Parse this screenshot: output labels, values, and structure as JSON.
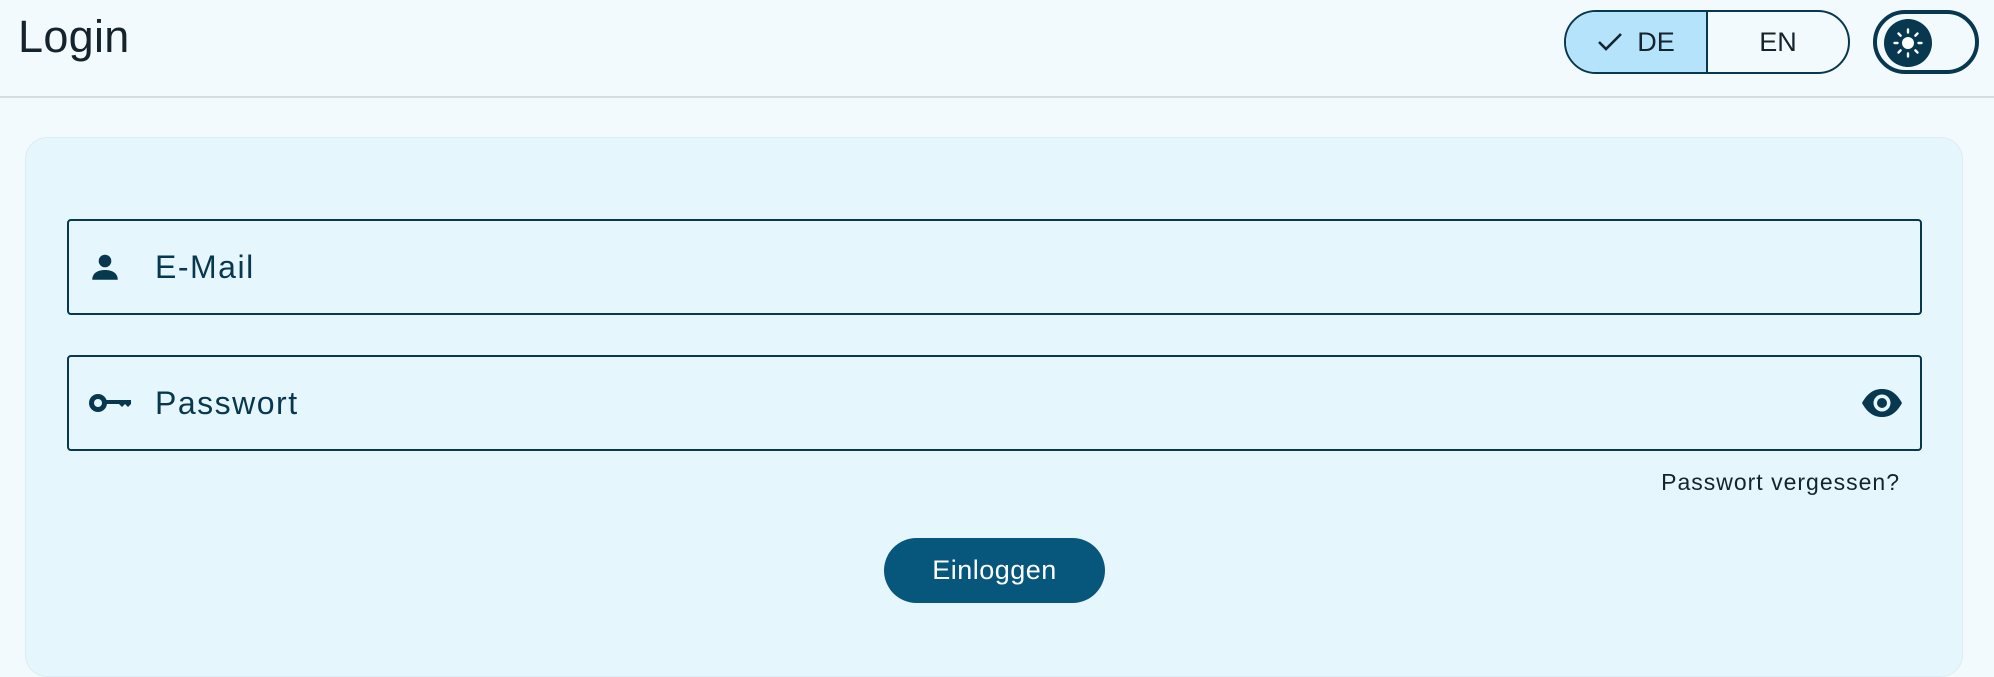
{
  "header": {
    "title": "Login",
    "language_toggle": {
      "options": [
        {
          "code": "DE",
          "label": "DE",
          "selected": true
        },
        {
          "code": "EN",
          "label": "EN",
          "selected": false
        }
      ]
    },
    "theme_switch": {
      "icon": "sun-icon",
      "state": "light"
    }
  },
  "form": {
    "email": {
      "placeholder": "E-Mail",
      "value": "",
      "icon": "person-icon"
    },
    "password": {
      "placeholder": "Passwort",
      "value": "",
      "icon": "key-icon",
      "visibility_icon": "eye-icon"
    },
    "forgot_password_label": "Passwort vergessen?",
    "submit_label": "Einloggen"
  },
  "colors": {
    "primary": "#07577d",
    "dark_accent": "#07384f",
    "selected_chip": "#b6e3fc",
    "card_bg": "#e6f6fd",
    "page_bg": "#f2fafe"
  }
}
